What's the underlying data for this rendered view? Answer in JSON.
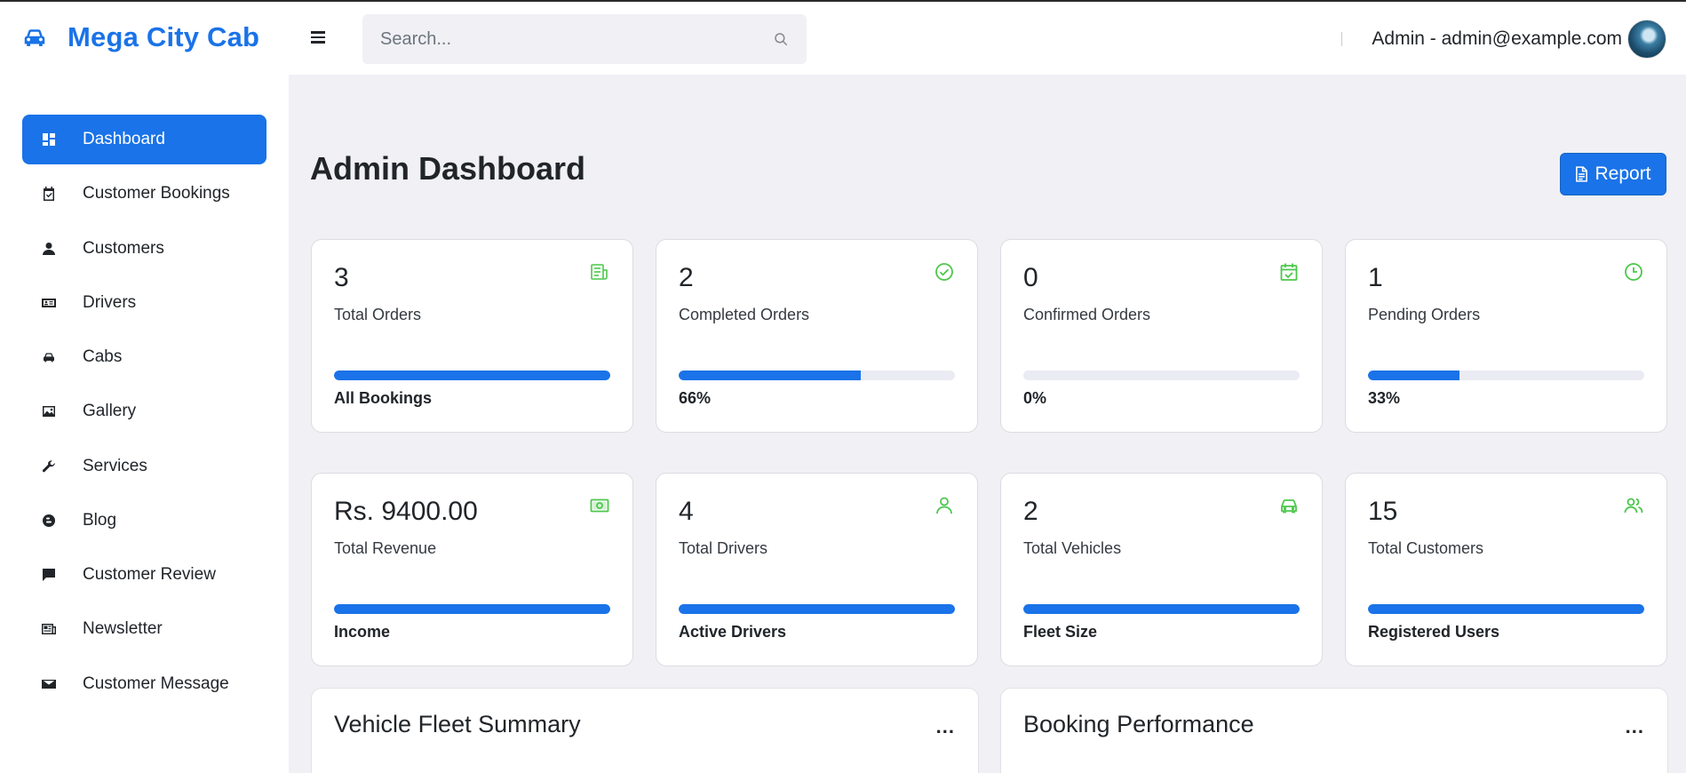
{
  "brand": {
    "name": "Mega City Cab",
    "icon": "car-icon"
  },
  "header": {
    "search_placeholder": "Search...",
    "user_label": "Admin - admin@example.com"
  },
  "sidebar": {
    "items": [
      {
        "label": "Dashboard",
        "icon": "dashboard-icon",
        "active": true
      },
      {
        "label": "Customer Bookings",
        "icon": "calendar-check-icon"
      },
      {
        "label": "Customers",
        "icon": "person-icon"
      },
      {
        "label": "Drivers",
        "icon": "id-card-icon"
      },
      {
        "label": "Cabs",
        "icon": "car-icon"
      },
      {
        "label": "Gallery",
        "icon": "image-icon"
      },
      {
        "label": "Services",
        "icon": "wrench-icon"
      },
      {
        "label": "Blog",
        "icon": "blog-icon"
      },
      {
        "label": "Customer Review",
        "icon": "chat-icon"
      },
      {
        "label": "Newsletter",
        "icon": "newspaper-icon"
      },
      {
        "label": "Customer Message",
        "icon": "envelope-icon"
      }
    ]
  },
  "main": {
    "title": "Admin Dashboard",
    "report_label": "Report",
    "cards": [
      {
        "value": "3",
        "label": "Total Orders",
        "footer": "All Bookings",
        "progress": 1.0,
        "icon": "receipt-icon"
      },
      {
        "value": "2",
        "label": "Completed Orders",
        "footer": "66%",
        "progress": 0.66,
        "icon": "check-circle-icon"
      },
      {
        "value": "0",
        "label": "Confirmed Orders",
        "footer": "0%",
        "progress": 0.0,
        "icon": "calendar-check-icon"
      },
      {
        "value": "1",
        "label": "Pending Orders",
        "footer": "33%",
        "progress": 0.33,
        "icon": "clock-icon"
      },
      {
        "value": "Rs. 9400.00",
        "label": "Total Revenue",
        "footer": "Income",
        "progress": 1.0,
        "icon": "cash-icon"
      },
      {
        "value": "4",
        "label": "Total Drivers",
        "footer": "Active Drivers",
        "progress": 1.0,
        "icon": "person-icon"
      },
      {
        "value": "2",
        "label": "Total Vehicles",
        "footer": "Fleet Size",
        "progress": 1.0,
        "icon": "car-icon"
      },
      {
        "value": "15",
        "label": "Total Customers",
        "footer": "Registered Users",
        "progress": 1.0,
        "icon": "people-icon"
      }
    ],
    "panels": [
      {
        "title": "Vehicle Fleet Summary",
        "menu": "..."
      },
      {
        "title": "Booking Performance",
        "menu": "..."
      }
    ]
  },
  "colors": {
    "accent": "#1a73e8",
    "icon_green": "#4cc74c",
    "background": "#f0f0f5"
  }
}
